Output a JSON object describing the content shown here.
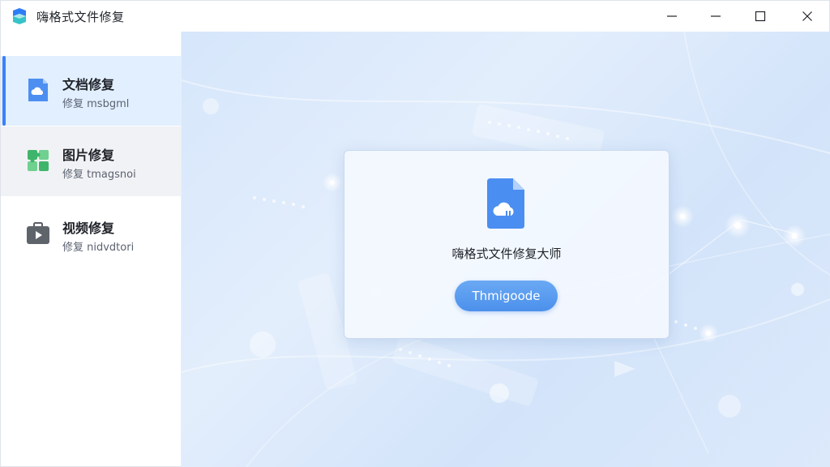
{
  "window": {
    "title": "嗨格式文件修复"
  },
  "sidebar": {
    "items": [
      {
        "label": "文档修复",
        "sub": "修复 msbgml",
        "icon": "document-cloud-icon",
        "active": true
      },
      {
        "label": "图片修复",
        "sub": "修复 tmagsnoi",
        "icon": "image-puzzle-icon",
        "active": false
      },
      {
        "label": "视频修复",
        "sub": "修复 nidvdtori",
        "icon": "video-play-icon",
        "active": false
      }
    ]
  },
  "main": {
    "card": {
      "title": "嗨格式文件修复大师",
      "button_label": "Thmigoode",
      "icon": "document-cloud-icon"
    }
  },
  "colors": {
    "accent": "#3b82f6",
    "active_bg": "#e2efff",
    "button": "#5b9cf0",
    "content_bg": "#d9e8fb"
  }
}
